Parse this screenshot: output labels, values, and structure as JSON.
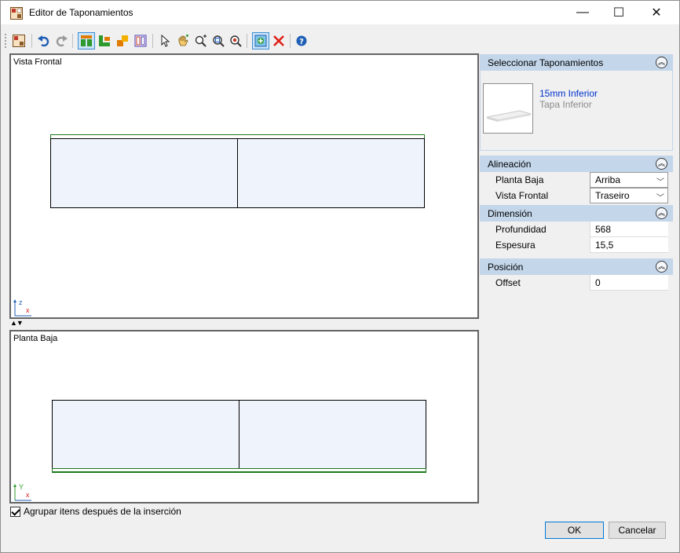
{
  "window": {
    "title": "Editor de Taponamientos",
    "controls": {
      "minimize": "—",
      "maximize": "☐",
      "close": "✕"
    }
  },
  "toolbar": {
    "icons": [
      "catalog-icon",
      "undo-icon",
      "redo-icon",
      "front-view-icon",
      "plan-view-icon",
      "side-view-icon",
      "doors-icon",
      "select-arrow-icon",
      "pan-hand-icon",
      "zoom-in-icon",
      "zoom-window-icon",
      "zoom-extents-icon",
      "insert-icon",
      "delete-icon",
      "help-icon"
    ]
  },
  "views": {
    "front": {
      "label": "Vista Frontal",
      "axis_v": "z",
      "axis_h": "x"
    },
    "plan": {
      "label": "Planta Baja",
      "axis_v": "Y",
      "axis_h": "x"
    }
  },
  "side_panel": {
    "catalog": {
      "header": "Seleccionar Taponamientos",
      "item_name": "15mm Inferior",
      "item_desc": "Tapa Inferior"
    },
    "alignment": {
      "header": "Alineación",
      "rows": [
        {
          "name": "Planta Baja",
          "value": "Arriba"
        },
        {
          "name": "Vista Frontal",
          "value": "Traseiro"
        }
      ]
    },
    "dimension": {
      "header": "Dimensión",
      "rows": [
        {
          "name": "Profundidad",
          "value": "568"
        },
        {
          "name": "Espesura",
          "value": "15,5"
        }
      ]
    },
    "position": {
      "header": "Posición",
      "rows": [
        {
          "name": "Offset",
          "value": "0"
        }
      ]
    }
  },
  "footer": {
    "group_checkbox_label": "Agrupar itens después de la inserción",
    "group_checked": true,
    "ok_label": "OK",
    "cancel_label": "Cancelar"
  },
  "colors": {
    "panel_header": "#c3d6ea",
    "part_fill": "#eef3fc",
    "part_outline": "#1b7a1b",
    "link_blue": "#0033cc"
  }
}
